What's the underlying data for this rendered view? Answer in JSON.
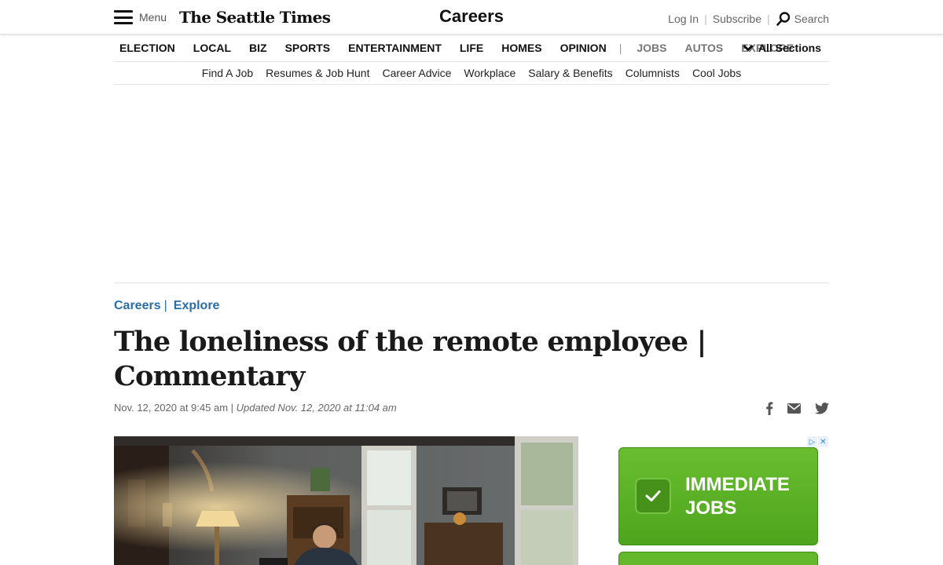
{
  "header": {
    "menu_label": "Menu",
    "logo": "The Seattle Times",
    "section_title": "Careers",
    "login": "Log In",
    "subscribe": "Subscribe",
    "search": "Search"
  },
  "main_nav": {
    "items": [
      "ELECTION",
      "LOCAL",
      "BIZ",
      "SPORTS",
      "ENTERTAINMENT",
      "LIFE",
      "HOMES",
      "OPINION"
    ],
    "separator": "|",
    "secondary": [
      "JOBS",
      "AUTOS",
      "EXPLORE"
    ],
    "all_sections": "All Sections"
  },
  "sub_nav": {
    "items": [
      "Find A Job",
      "Resumes & Job Hunt",
      "Career Advice",
      "Workplace",
      "Salary & Benefits",
      "Columnists",
      "Cool Jobs"
    ]
  },
  "article": {
    "breadcrumbs": [
      "Careers",
      "Explore"
    ],
    "crumb_separator": "|",
    "headline_line1": "The loneliness of the remote employee |",
    "headline_line2": "Commentary",
    "published": "Nov. 12, 2020 at 9:45 am",
    "date_separator": "|",
    "updated": "Updated Nov. 12, 2020 at 11:04 am"
  },
  "ad": {
    "line1": "IMMEDIATE",
    "line2": "JOBS",
    "accent": "#5cb325"
  },
  "colors": {
    "link": "#2a6ea8",
    "text": "#1a1a1a"
  }
}
